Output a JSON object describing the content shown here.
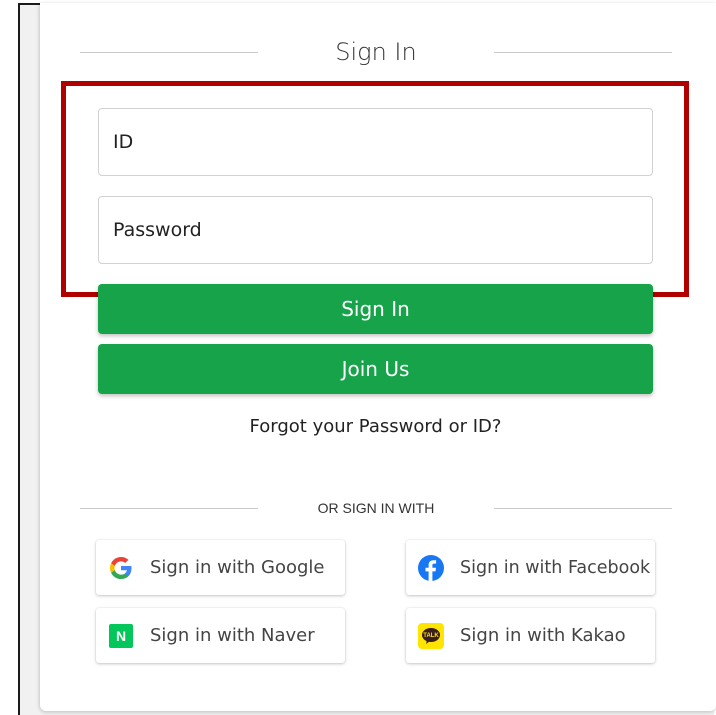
{
  "form": {
    "title": "Sign In",
    "id_placeholder": "ID",
    "password_placeholder": "Password",
    "signin_label": "Sign In",
    "join_label": "Join Us",
    "forgot_label": "Forgot your Password or ID?"
  },
  "social": {
    "divider_label": "OR SIGN IN WITH",
    "google_label": "Sign in with Google",
    "facebook_label": "Sign in with Facebook",
    "naver_label": "Sign in with Naver",
    "kakao_label": "Sign in with Kakao",
    "naver_letter": "N",
    "kakao_talk": "TALK"
  },
  "icons": {
    "google": "google-icon",
    "facebook": "facebook-icon",
    "naver": "naver-icon",
    "kakao": "kakao-icon"
  },
  "colors": {
    "primary_button": "#17a34a",
    "highlight_border": "#b00000",
    "facebook": "#1877f2",
    "naver": "#03c75a",
    "kakao": "#fee500"
  }
}
